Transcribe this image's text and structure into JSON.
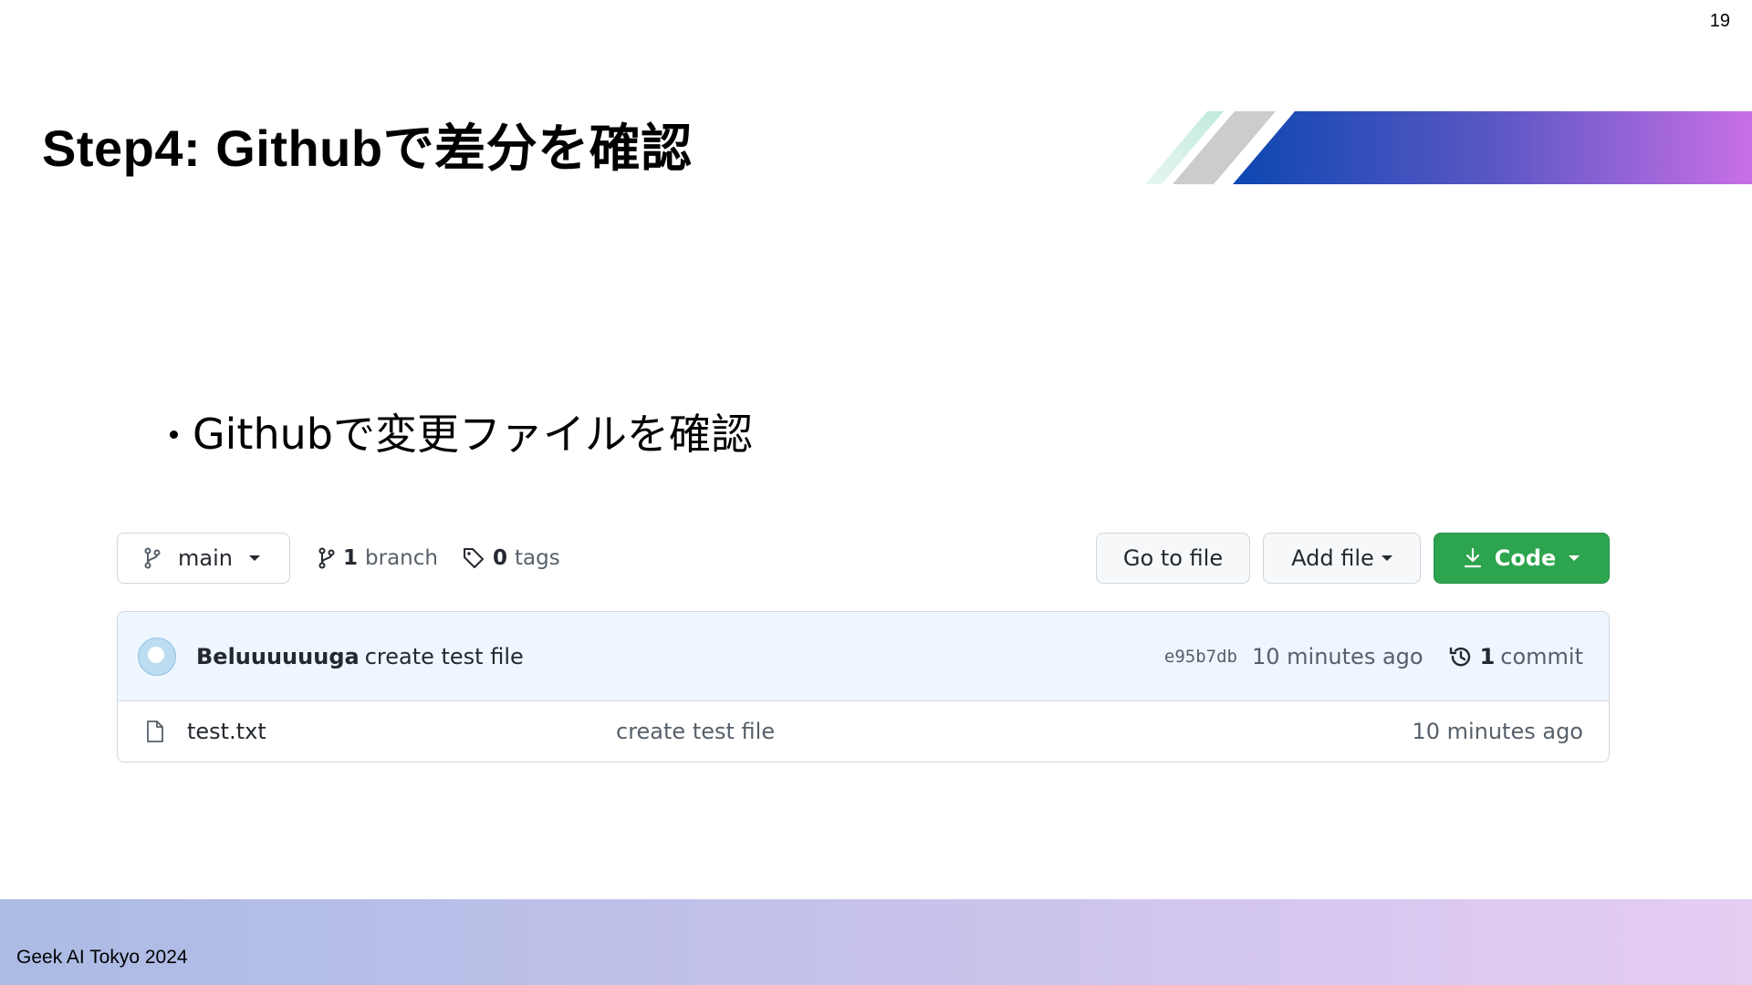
{
  "page_number": "19",
  "title": "Step4: Githubで差分を確認",
  "bullet": "Githubで変更ファイルを確認",
  "github": {
    "branch_selector": "main",
    "branch_count": "1",
    "branch_label": "branch",
    "tag_count": "0",
    "tag_label": "tags",
    "go_to_file": "Go to file",
    "add_file": "Add file",
    "code": "Code",
    "latest_commit": {
      "author": "Beluuuuuuga",
      "message": "create test file",
      "sha": "e95b7db",
      "time": "10 minutes ago",
      "commit_count": "1",
      "commit_label": "commit"
    },
    "files": [
      {
        "name": "test.txt",
        "commit_message": "create test file",
        "time": "10 minutes ago"
      }
    ]
  },
  "footer": "Geek AI Tokyo 2024",
  "colors": {
    "code_button": "#2da44e",
    "commit_row_bg": "#eef6ff",
    "accent_gradient_start": "#0d47b0",
    "accent_gradient_end": "#c86fe6"
  }
}
